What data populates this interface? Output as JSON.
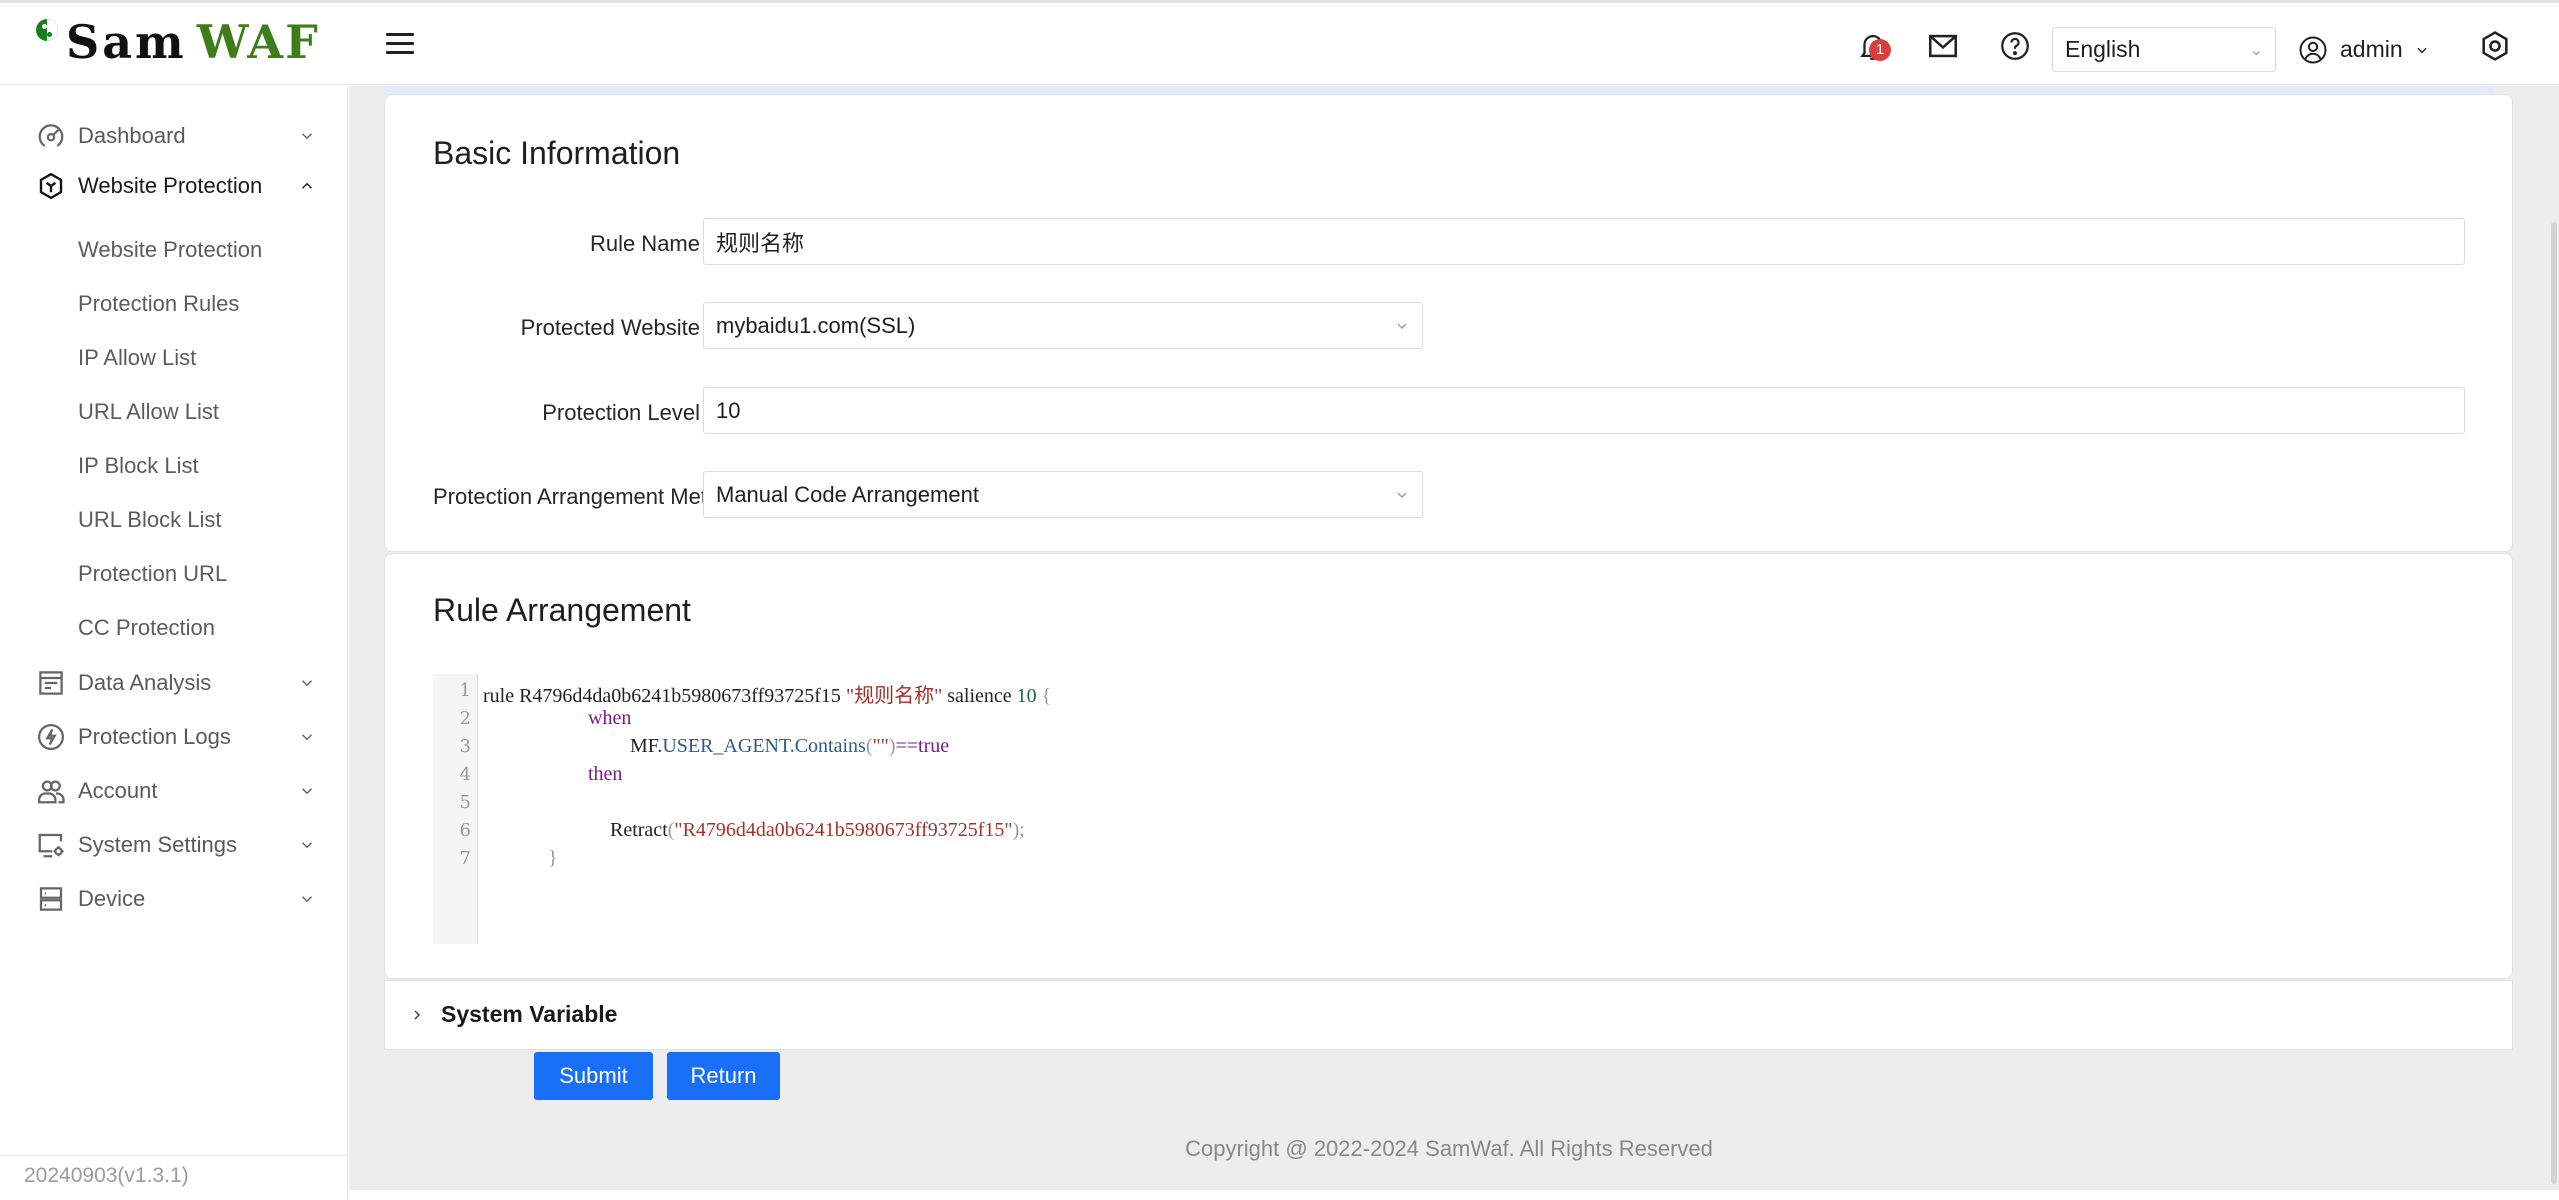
{
  "header": {
    "logo_part1": "Sam",
    "logo_part2": "WAF",
    "notification_count": "1",
    "language": "English",
    "user": "admin",
    "icons": [
      "menu-icon",
      "bell-icon",
      "mail-icon",
      "help-icon",
      "user-icon",
      "settings-icon"
    ]
  },
  "sidebar": {
    "items": [
      {
        "label": "Dashboard",
        "icon": "dashboard-icon",
        "expanded": false
      },
      {
        "label": "Website Protection",
        "icon": "shield-icon",
        "expanded": true
      },
      {
        "label": "Data Analysis",
        "icon": "data-analysis-icon",
        "expanded": false
      },
      {
        "label": "Protection Logs",
        "icon": "lightning-icon",
        "expanded": false
      },
      {
        "label": "Account",
        "icon": "users-icon",
        "expanded": false
      },
      {
        "label": "System Settings",
        "icon": "monitor-settings-icon",
        "expanded": false
      },
      {
        "label": "Device",
        "icon": "server-icon",
        "expanded": false
      }
    ],
    "subitems": [
      "Website Protection",
      "Protection Rules",
      "IP Allow List",
      "URL Allow List",
      "IP Block List",
      "URL Block List",
      "Protection URL",
      "CC Protection"
    ],
    "version": "20240903(v1.3.1)"
  },
  "basic_info": {
    "title": "Basic Information",
    "rule_name_label": "Rule Name",
    "rule_name_value": "规则名称",
    "website_label": "Protected Website",
    "website_value": "mybaidu1.com(SSL)",
    "level_label": "Protection Level",
    "level_value": "10",
    "arrangement_label": "Protection Arrangement Method",
    "arrangement_value": "Manual Code Arrangement"
  },
  "rule_arrangement": {
    "title": "Rule Arrangement",
    "line_numbers": [
      "1",
      "2",
      "3",
      "4",
      "5",
      "6",
      "7"
    ],
    "code": {
      "l1_rule": "rule R4796d4da0b6241b5980673ff93725f15 ",
      "l1_name": "\"规则名称\"",
      "l1_salience": " salience ",
      "l1_num": "10",
      "l1_brace": " {",
      "l2_when": "when",
      "l3_mf": "MF.",
      "l3_prop": "USER_AGENT.Contains",
      "l3_paren_open": "(",
      "l3_str": "\"\"",
      "l3_paren_close": ")",
      "l3_rest": "==true",
      "l4_then": "then",
      "l6_fn": "Retract",
      "l6_paren_open": "(",
      "l6_str": "\"R4796d4da0b6241b5980673ff93725f15\"",
      "l6_paren_close": ");",
      "l7_brace": "}"
    }
  },
  "system_variable": {
    "label": "System Variable"
  },
  "actions": {
    "submit": "Submit",
    "return": "Return"
  },
  "footer": {
    "copyright": "Copyright @ 2022-2024 SamWaf. All Rights Reserved"
  },
  "colors": {
    "primary": "#1a6ff9",
    "badge": "#d9403b",
    "logo_green": "#3e7d1a"
  }
}
